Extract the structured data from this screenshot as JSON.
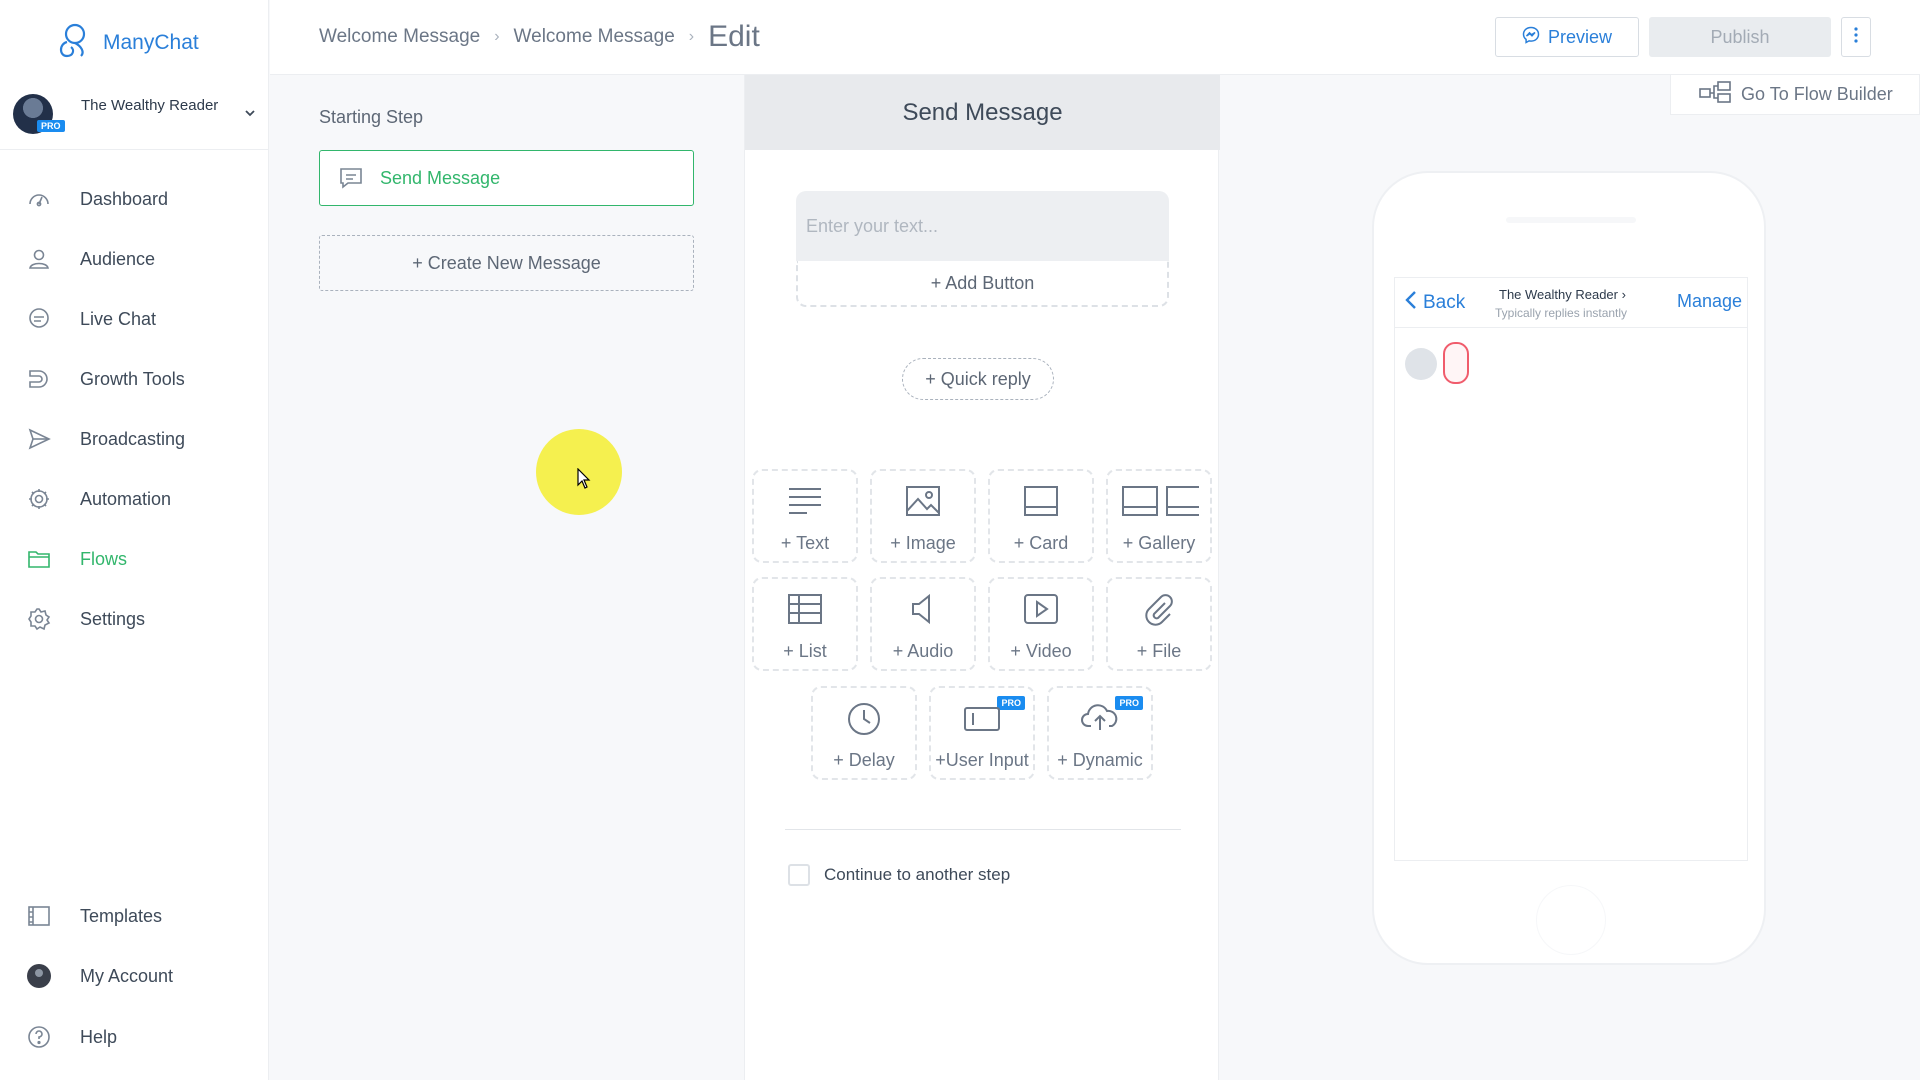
{
  "app": {
    "logo_text": "ManyChat"
  },
  "account": {
    "name": "The Wealthy Reader",
    "badge": "PRO"
  },
  "sidebar": {
    "items": [
      {
        "label": "Dashboard",
        "icon": "dashboard-icon"
      },
      {
        "label": "Audience",
        "icon": "user-icon"
      },
      {
        "label": "Live Chat",
        "icon": "chat-icon"
      },
      {
        "label": "Growth Tools",
        "icon": "magnet-icon"
      },
      {
        "label": "Broadcasting",
        "icon": "send-icon"
      },
      {
        "label": "Automation",
        "icon": "automation-icon"
      },
      {
        "label": "Flows",
        "icon": "folder-icon",
        "active": true
      },
      {
        "label": "Settings",
        "icon": "gear-icon"
      }
    ],
    "bottom": [
      {
        "label": "Templates",
        "icon": "templates-icon"
      },
      {
        "label": "My Account",
        "icon": "avatar"
      },
      {
        "label": "Help",
        "icon": "help-icon"
      }
    ]
  },
  "breadcrumb": {
    "items": [
      "Welcome Message",
      "Welcome Message"
    ],
    "current": "Edit"
  },
  "header": {
    "preview_label": "Preview",
    "publish_label": "Publish"
  },
  "steps": {
    "title": "Starting Step",
    "active_step": "Send Message",
    "create_label": "+ Create New Message"
  },
  "editor": {
    "title": "Send Message",
    "text_placeholder": "Enter your text...",
    "add_button_label": "+ Add Button",
    "quick_reply_label": "+ Quick reply",
    "tiles": [
      {
        "label": "+ Text",
        "icon": "text-icon"
      },
      {
        "label": "+ Image",
        "icon": "image-icon"
      },
      {
        "label": "+ Card",
        "icon": "card-icon"
      },
      {
        "label": "+ Gallery",
        "icon": "gallery-icon"
      },
      {
        "label": "+ List",
        "icon": "list-icon"
      },
      {
        "label": "+ Audio",
        "icon": "audio-icon"
      },
      {
        "label": "+ Video",
        "icon": "video-icon"
      },
      {
        "label": "+ File",
        "icon": "attachment-icon"
      },
      {
        "label": "+ Delay",
        "icon": "clock-icon"
      },
      {
        "label": "+User Input",
        "icon": "input-icon",
        "pro": "PRO"
      },
      {
        "label": "+ Dynamic",
        "icon": "cloud-upload-icon",
        "pro": "PRO"
      }
    ],
    "continue_label": "Continue to another step"
  },
  "flow_builder": {
    "label": "Go To Flow Builder"
  },
  "phone": {
    "back_label": "Back",
    "bot_name": "The Wealthy Reader",
    "bot_status": "Typically replies instantly",
    "manage_label": "Manage"
  },
  "colors": {
    "accent_blue": "#2a7fd9",
    "accent_green": "#32b66c",
    "pro_blue": "#1a8cf0"
  }
}
